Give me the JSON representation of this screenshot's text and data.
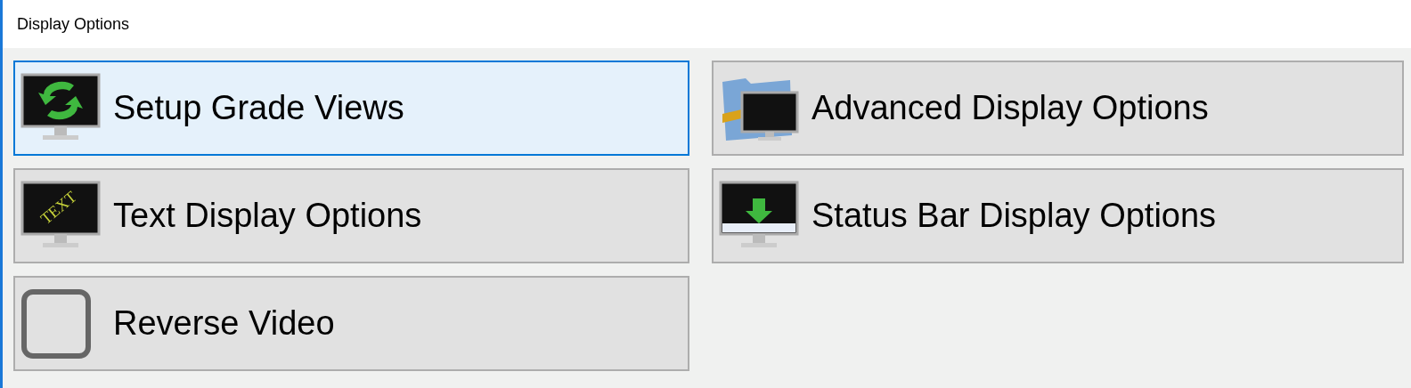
{
  "window": {
    "title": "Display Options"
  },
  "options": [
    {
      "kind": "refresh",
      "label": "Setup Grade Views",
      "selected": true
    },
    {
      "kind": "folder",
      "label": "Advanced Display Options",
      "selected": false
    },
    {
      "kind": "text",
      "icon_text": "TEXT",
      "label": "Text Display Options",
      "selected": false
    },
    {
      "kind": "status",
      "label": "Status Bar Display Options",
      "selected": false
    },
    {
      "kind": "checkbox",
      "label": "Reverse Video",
      "checked": false,
      "selected": false
    }
  ]
}
